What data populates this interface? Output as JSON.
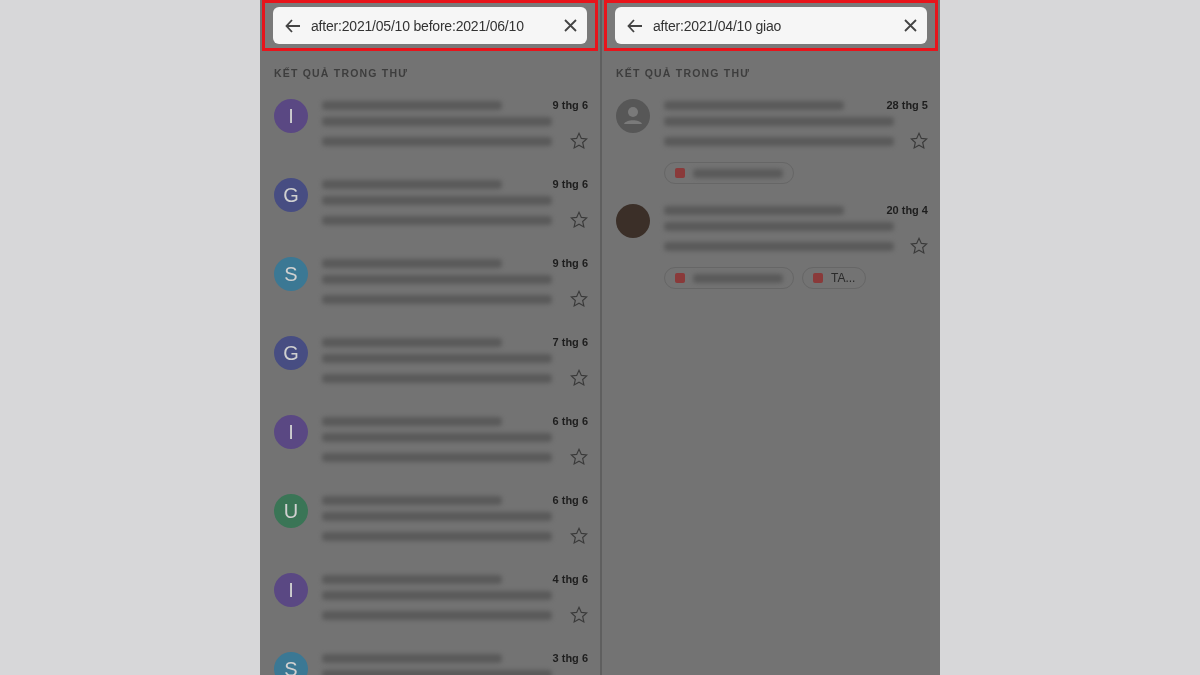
{
  "panels": [
    {
      "search": {
        "value": "after:2021/05/10 before:2021/06/10"
      },
      "section_title": "KẾT QUẢ TRONG THƯ",
      "results": [
        {
          "avatar": {
            "kind": "letter",
            "letter": "I",
            "color": "#5a4883"
          },
          "date": "9 thg 6"
        },
        {
          "avatar": {
            "kind": "letter",
            "letter": "G",
            "color": "#474d82"
          },
          "date": "9 thg 6"
        },
        {
          "avatar": {
            "kind": "letter",
            "letter": "S",
            "color": "#3b7894"
          },
          "date": "9 thg 6"
        },
        {
          "avatar": {
            "kind": "letter",
            "letter": "G",
            "color": "#474d82"
          },
          "date": "7 thg 6"
        },
        {
          "avatar": {
            "kind": "letter",
            "letter": "I",
            "color": "#5a4883"
          },
          "date": "6 thg 6"
        },
        {
          "avatar": {
            "kind": "letter",
            "letter": "U",
            "color": "#3a7556"
          },
          "date": "6 thg 6"
        },
        {
          "avatar": {
            "kind": "letter",
            "letter": "I",
            "color": "#5a4883"
          },
          "date": "4 thg 6"
        },
        {
          "avatar": {
            "kind": "letter",
            "letter": "S",
            "color": "#3b7894"
          },
          "date": "3 thg 6"
        }
      ]
    },
    {
      "search": {
        "value": "after:2021/04/10 giao"
      },
      "section_title": "KẾT QUẢ TRONG THƯ",
      "results": [
        {
          "avatar": {
            "kind": "person"
          },
          "date": "28 thg 5",
          "chips": [
            {
              "kind": "blurred"
            }
          ]
        },
        {
          "avatar": {
            "kind": "photo"
          },
          "date": "20 thg 4",
          "chips": [
            {
              "kind": "blurred"
            },
            {
              "kind": "text",
              "label": "TA..."
            }
          ]
        }
      ]
    }
  ]
}
